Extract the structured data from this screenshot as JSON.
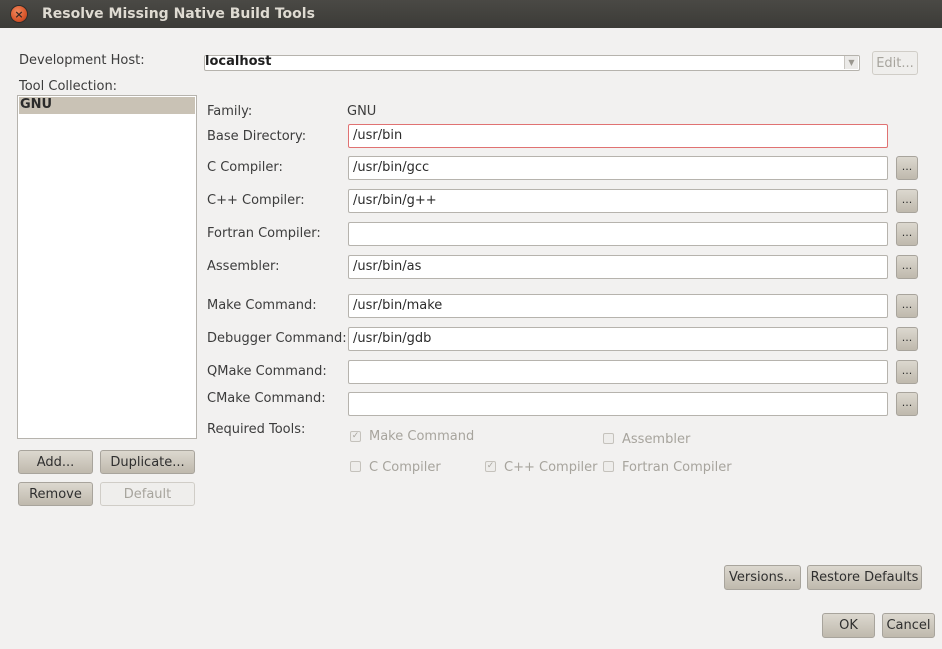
{
  "window": {
    "title": "Resolve Missing Native Build Tools"
  },
  "host": {
    "label": "Development Host:",
    "value": "localhost",
    "edit_label": "Edit..."
  },
  "tool_collection": {
    "label": "Tool Collection:",
    "items": [
      "GNU"
    ],
    "buttons": {
      "add": "Add...",
      "duplicate": "Duplicate...",
      "remove": "Remove",
      "default": "Default"
    }
  },
  "details": {
    "family_label": "Family:",
    "family_value": "GNU",
    "base_dir_label": "Base Directory:",
    "base_dir_value": "/usr/bin",
    "tools": [
      {
        "label": "C Compiler:",
        "value": "/usr/bin/gcc"
      },
      {
        "label": "C++ Compiler:",
        "value": "/usr/bin/g++"
      },
      {
        "label": "Fortran Compiler:",
        "value": ""
      },
      {
        "label": "Assembler:",
        "value": "/usr/bin/as"
      },
      {
        "label": "Make Command:",
        "value": "/usr/bin/make"
      },
      {
        "label": "Debugger Command:",
        "value": "/usr/bin/gdb"
      },
      {
        "label": "QMake Command:",
        "value": ""
      },
      {
        "label": "CMake Command:",
        "value": ""
      }
    ],
    "browse_label": "...",
    "required_label": "Required Tools:",
    "required": {
      "make": {
        "label": "Make Command",
        "checked": true
      },
      "assembler": {
        "label": "Assembler",
        "checked": false
      },
      "c": {
        "label": "C Compiler",
        "checked": false
      },
      "cpp": {
        "label": "C++ Compiler",
        "checked": true
      },
      "fortran": {
        "label": "Fortran Compiler",
        "checked": false
      }
    }
  },
  "footer": {
    "versions": "Versions...",
    "restore": "Restore Defaults",
    "ok": "OK",
    "cancel": "Cancel"
  },
  "colors": {
    "titlebar": "#3c3b37",
    "accent_error": "#e07272",
    "selection": "#c9c2b5"
  }
}
